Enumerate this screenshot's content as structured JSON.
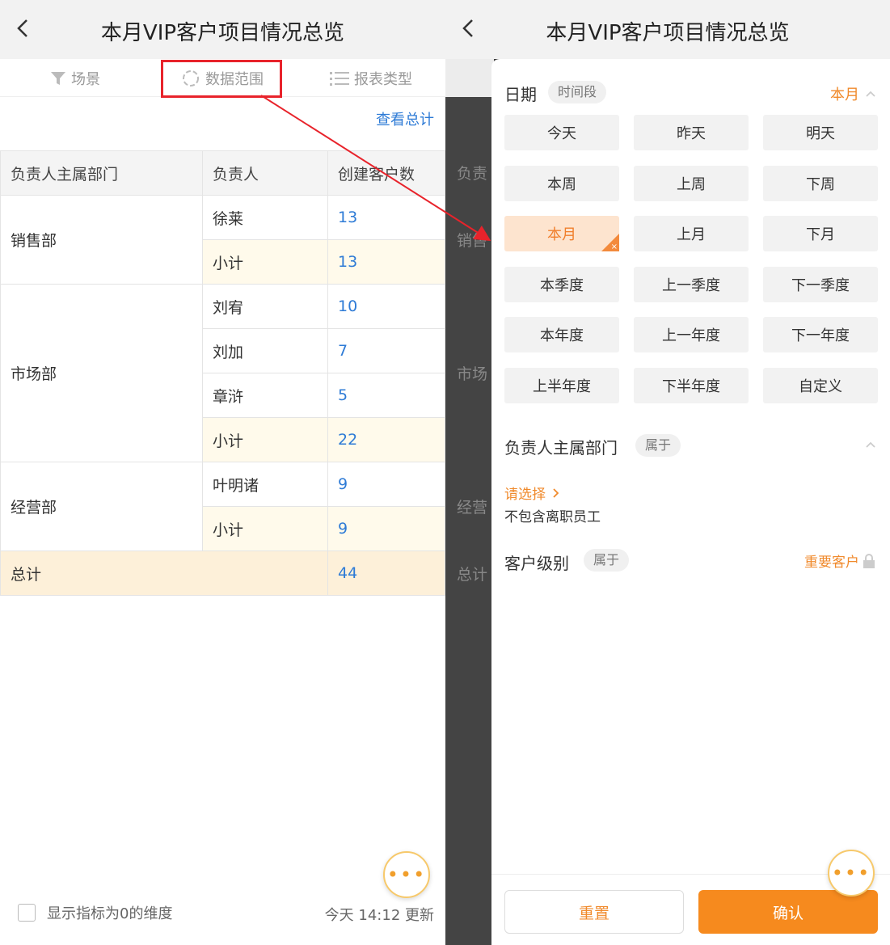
{
  "left": {
    "title": "本月VIP客户项目情况总览",
    "tabs": [
      {
        "label": "场景",
        "icon": "filter-icon"
      },
      {
        "label": "数据范围",
        "icon": "scope-icon"
      },
      {
        "label": "报表类型",
        "icon": "list-icon"
      }
    ],
    "view_total": "查看总计",
    "table": {
      "headers": [
        "负责人主属部门",
        "负责人",
        "创建客户数"
      ],
      "groups": [
        {
          "dept": "销售部",
          "rows": [
            {
              "name": "徐莱",
              "value": "13"
            },
            {
              "name": "小计",
              "value": "13",
              "sub": true
            }
          ]
        },
        {
          "dept": "市场部",
          "rows": [
            {
              "name": "刘宥",
              "value": "10"
            },
            {
              "name": "刘加",
              "value": "7"
            },
            {
              "name": "章浒",
              "value": "5"
            },
            {
              "name": "小计",
              "value": "22",
              "sub": true
            }
          ]
        },
        {
          "dept": "经营部",
          "rows": [
            {
              "name": "叶明诸",
              "value": "9"
            },
            {
              "name": "小计",
              "value": "9",
              "sub": true
            }
          ]
        }
      ],
      "total_label": "总计",
      "total_value": "44"
    },
    "footer": {
      "checkbox_label": "显示指标为0的维度",
      "updated": "今天 14:12 更新"
    },
    "more": "•••"
  },
  "right": {
    "title": "本月VIP客户项目情况总览",
    "bg_labels": [
      "负责",
      "销售",
      "市场",
      "经营",
      "总计"
    ],
    "date": {
      "label": "日期",
      "tag": "时间段",
      "current": "本月",
      "options": [
        "今天",
        "昨天",
        "明天",
        "本周",
        "上周",
        "下周",
        "本月",
        "上月",
        "下月",
        "本季度",
        "上一季度",
        "下一季度",
        "本年度",
        "上一年度",
        "下一年度",
        "上半年度",
        "下半年度",
        "自定义"
      ],
      "selected": "本月"
    },
    "dept": {
      "label": "负责人主属部门",
      "tag": "属于",
      "choose": "请选择",
      "note": "不包含离职员工"
    },
    "level": {
      "label": "客户级别",
      "tag": "属于",
      "value": "重要客户"
    },
    "buttons": {
      "reset": "重置",
      "confirm": "确认"
    },
    "more": "•••"
  },
  "colors": {
    "accent": "#f68a1e",
    "link": "#2e7bd6",
    "highlight": "#e8232b"
  }
}
